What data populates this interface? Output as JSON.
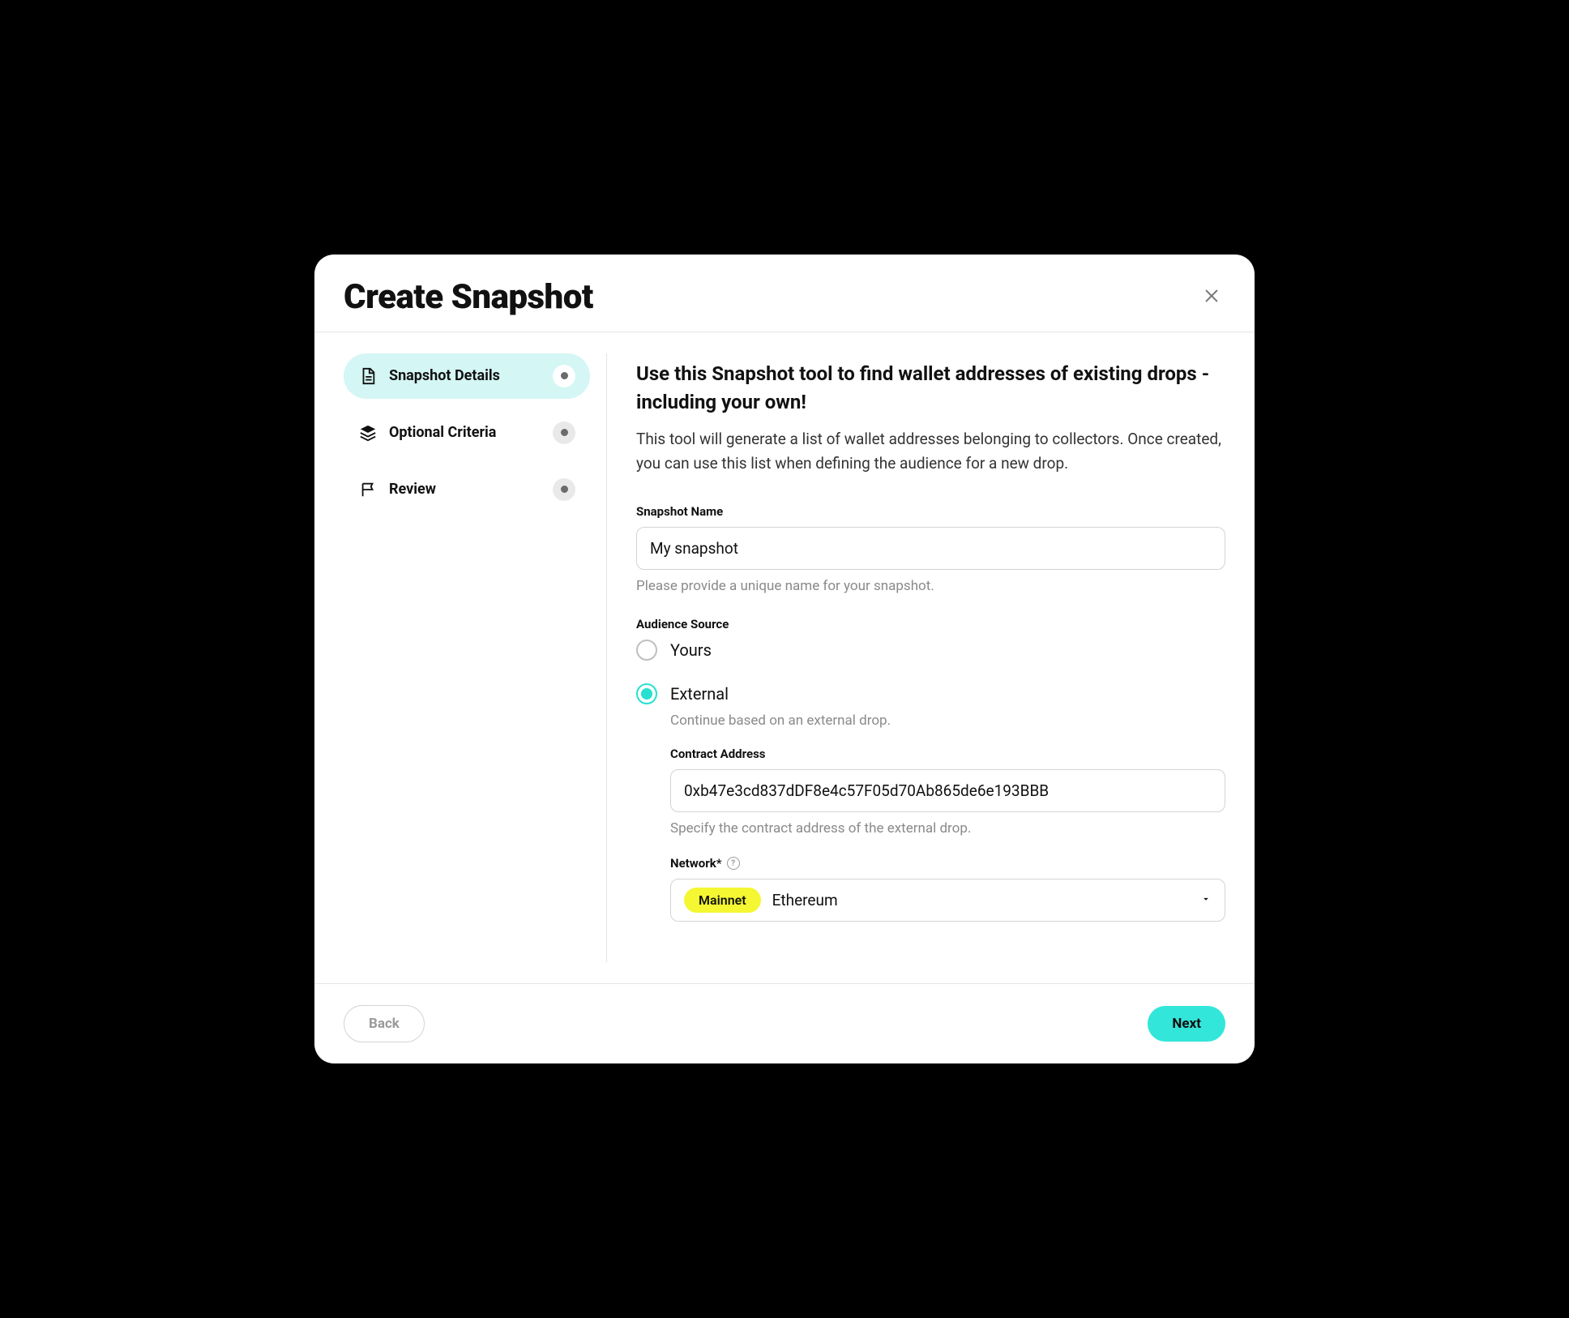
{
  "header": {
    "title": "Create Snapshot"
  },
  "sidebar": {
    "steps": [
      {
        "label": "Snapshot Details"
      },
      {
        "label": "Optional Criteria"
      },
      {
        "label": "Review"
      }
    ]
  },
  "content": {
    "heading": "Use this Snapshot tool to find wallet addresses of existing drops - including your own!",
    "description": "This tool will generate a list of wallet addresses belonging to collectors. Once created, you can use this list when defining the audience for a new drop.",
    "snapshot_name": {
      "label": "Snapshot Name",
      "value": "My snapshot",
      "help": "Please provide a unique name for your snapshot."
    },
    "audience_source": {
      "label": "Audience Source",
      "options": {
        "yours": {
          "label": "Yours"
        },
        "external": {
          "label": "External",
          "help": "Continue based on an external drop.",
          "contract": {
            "label": "Contract Address",
            "value": "0xb47e3cd837dDF8e4c57F05d70Ab865de6e193BBB",
            "help": "Specify the contract address of the external drop."
          },
          "network": {
            "label": "Network*",
            "badge": "Mainnet",
            "value": "Ethereum"
          }
        }
      }
    }
  },
  "footer": {
    "back": "Back",
    "next": "Next"
  }
}
